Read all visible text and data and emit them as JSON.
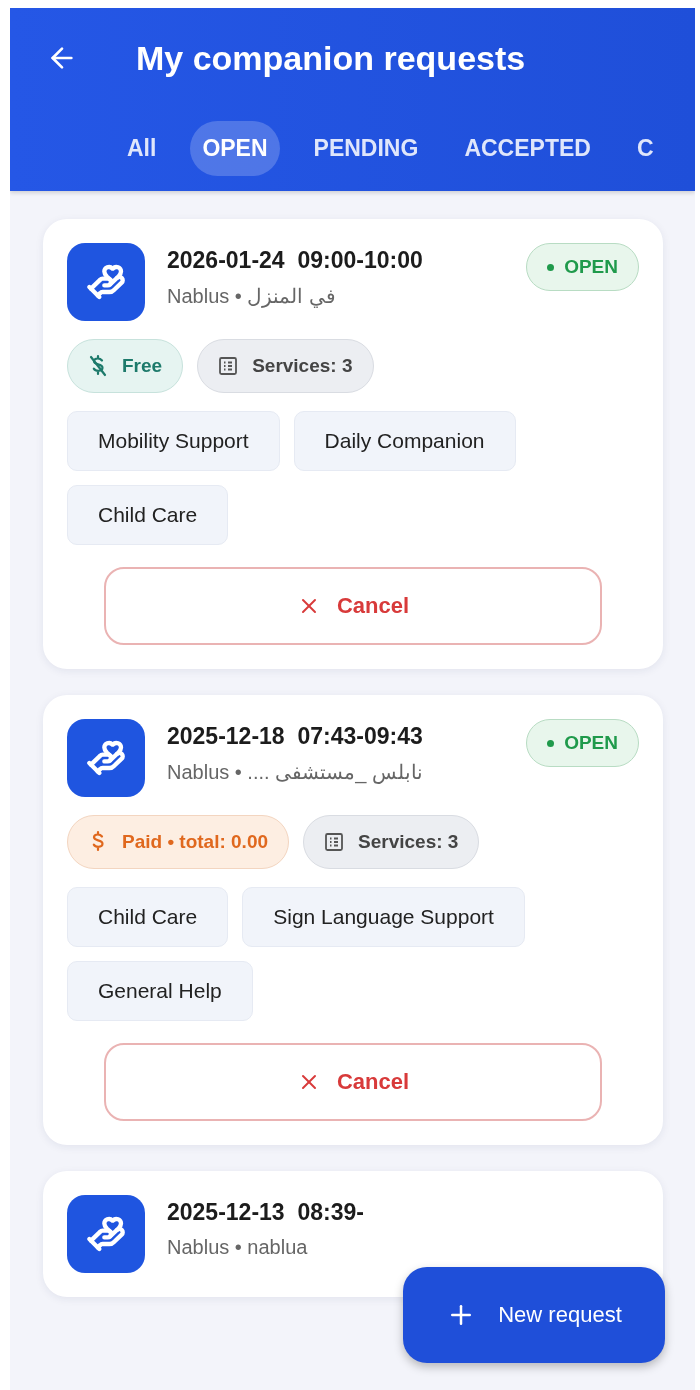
{
  "header": {
    "title": "My companion requests"
  },
  "tabs": [
    {
      "label": "All",
      "selected": false
    },
    {
      "label": "OPEN",
      "selected": true
    },
    {
      "label": "PENDING",
      "selected": false
    },
    {
      "label": "ACCEPTED",
      "selected": false
    },
    {
      "label": "C",
      "selected": false
    }
  ],
  "requests": [
    {
      "datetime": "2026-01-24  09:00-10:00",
      "location": "Nablus • في المنزل",
      "status": "OPEN",
      "fee": {
        "kind": "free",
        "label": "Free"
      },
      "services_count": "Services: 3",
      "services": [
        "Mobility Support",
        "Daily Companion",
        "Child Care"
      ],
      "cancel": "Cancel"
    },
    {
      "datetime": "2025-12-18  07:43-09:43",
      "location": "Nablus • .... نابلس _مستشفى",
      "status": "OPEN",
      "fee": {
        "kind": "paid",
        "label": "Paid • total: 0.00"
      },
      "services_count": "Services: 3",
      "services": [
        "Child Care",
        "Sign Language Support",
        "General Help"
      ],
      "cancel": "Cancel"
    },
    {
      "datetime": "2025-12-13  08:39-",
      "location": "Nablus • nablua"
    }
  ],
  "fab": {
    "label": "New request"
  }
}
